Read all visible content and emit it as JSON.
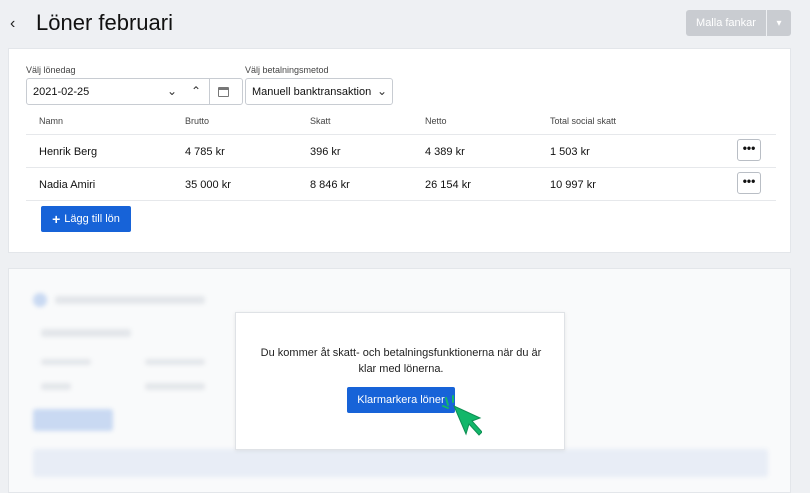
{
  "header": {
    "back_icon": "chevron-left-icon",
    "title": "Löner februari",
    "mall_button": "Mallа fankar"
  },
  "filters": {
    "date_label": "Välj lönedag",
    "date_value": "2021-02-25",
    "payment_label": "Välj betalningsmetod",
    "payment_value": "Manuell banktransaktion"
  },
  "table": {
    "columns": [
      "Namn",
      "Brutto",
      "Skatt",
      "Netto",
      "Total social skatt"
    ],
    "rows": [
      {
        "name": "Henrik Berg",
        "brutto": "4 785 kr",
        "skatt": "396 kr",
        "netto": "4 389 kr",
        "social": "1 503 kr"
      },
      {
        "name": "Nadia Amiri",
        "brutto": "35 000 kr",
        "skatt": "8 846 kr",
        "netto": "26 154 kr",
        "social": "10 997 kr"
      }
    ],
    "more_label": "•••"
  },
  "add_button": {
    "icon": "plus-icon",
    "label": "Lägg till lön"
  },
  "modal": {
    "text": "Du kommer åt skatt- och betalningsfunktionerna när du är klar med lönerna.",
    "button": "Klarmarkera löner"
  },
  "colors": {
    "primary": "#1763d8",
    "cursor": "#12b76a"
  }
}
